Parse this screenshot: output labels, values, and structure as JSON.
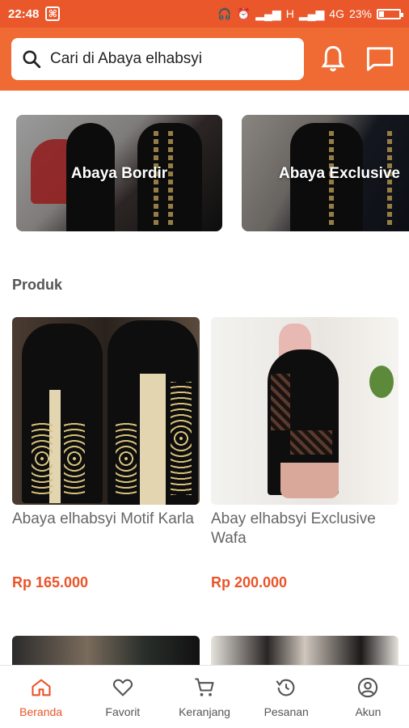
{
  "status_bar": {
    "time": "22:48",
    "app_icon": "app-notification-icon",
    "network_label_1": "H",
    "network_label_2": "4G",
    "battery": "23%",
    "battery_level": 0.23
  },
  "header": {
    "search": {
      "placeholder": "Cari di Abaya elhabsyi",
      "icon": "search-icon"
    },
    "notification_icon": "bell-icon",
    "chat_icon": "chat-icon"
  },
  "categories": [
    {
      "label": "Abaya Bordir"
    },
    {
      "label": "Abaya Exclusive"
    }
  ],
  "section": {
    "title": "Produk"
  },
  "products": [
    {
      "name": "Abaya elhabsyi Motif Karla",
      "price": "Rp 165.000"
    },
    {
      "name": "Abay elhabsyi Exclusive Wafa",
      "price": "Rp 200.000"
    }
  ],
  "bottom_nav": {
    "items": [
      {
        "label": "Beranda",
        "icon": "home-icon",
        "active": true
      },
      {
        "label": "Favorit",
        "icon": "heart-icon",
        "active": false
      },
      {
        "label": "Keranjang",
        "icon": "cart-icon",
        "active": false
      },
      {
        "label": "Pesanan",
        "icon": "history-icon",
        "active": false
      },
      {
        "label": "Akun",
        "icon": "account-icon",
        "active": false
      }
    ]
  },
  "colors": {
    "accent": "#f06a33",
    "price": "#ea5429",
    "status_bar": "#e9572b"
  }
}
